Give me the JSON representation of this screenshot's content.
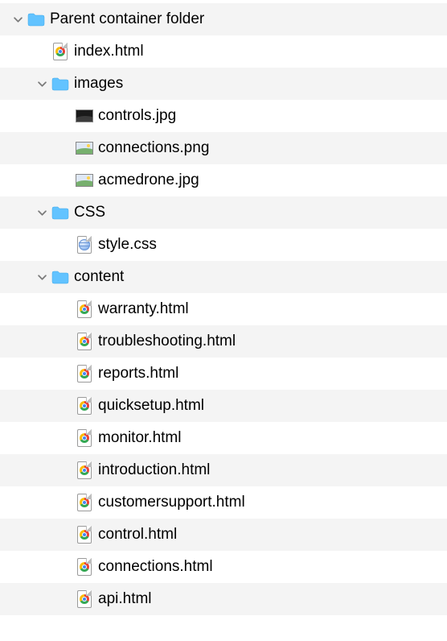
{
  "tree": [
    {
      "type": "folder",
      "expanded": true,
      "depth": 0,
      "name": "Parent container folder",
      "icon": "folder-icon"
    },
    {
      "type": "file",
      "depth": 1,
      "name": "index.html",
      "icon": "chrome-html-icon"
    },
    {
      "type": "folder",
      "expanded": true,
      "depth": 1,
      "name": "images",
      "icon": "folder-icon"
    },
    {
      "type": "file",
      "depth": 2,
      "name": "controls.jpg",
      "icon": "image-jpg-icon"
    },
    {
      "type": "file",
      "depth": 2,
      "name": "connections.png",
      "icon": "image-png-icon"
    },
    {
      "type": "file",
      "depth": 2,
      "name": "acmedrone.jpg",
      "icon": "image-jpg-icon"
    },
    {
      "type": "folder",
      "expanded": true,
      "depth": 1,
      "name": "CSS",
      "icon": "folder-icon"
    },
    {
      "type": "file",
      "depth": 2,
      "name": "style.css",
      "icon": "css-file-icon"
    },
    {
      "type": "folder",
      "expanded": true,
      "depth": 1,
      "name": "content",
      "icon": "folder-icon"
    },
    {
      "type": "file",
      "depth": 2,
      "name": "warranty.html",
      "icon": "chrome-html-icon"
    },
    {
      "type": "file",
      "depth": 2,
      "name": "troubleshooting.html",
      "icon": "chrome-html-icon"
    },
    {
      "type": "file",
      "depth": 2,
      "name": "reports.html",
      "icon": "chrome-html-icon"
    },
    {
      "type": "file",
      "depth": 2,
      "name": "quicksetup.html",
      "icon": "chrome-html-icon"
    },
    {
      "type": "file",
      "depth": 2,
      "name": "monitor.html",
      "icon": "chrome-html-icon"
    },
    {
      "type": "file",
      "depth": 2,
      "name": "introduction.html",
      "icon": "chrome-html-icon"
    },
    {
      "type": "file",
      "depth": 2,
      "name": "customersupport.html",
      "icon": "chrome-html-icon"
    },
    {
      "type": "file",
      "depth": 2,
      "name": "control.html",
      "icon": "chrome-html-icon"
    },
    {
      "type": "file",
      "depth": 2,
      "name": "connections.html",
      "icon": "chrome-html-icon"
    },
    {
      "type": "file",
      "depth": 2,
      "name": "api.html",
      "icon": "chrome-html-icon"
    }
  ]
}
